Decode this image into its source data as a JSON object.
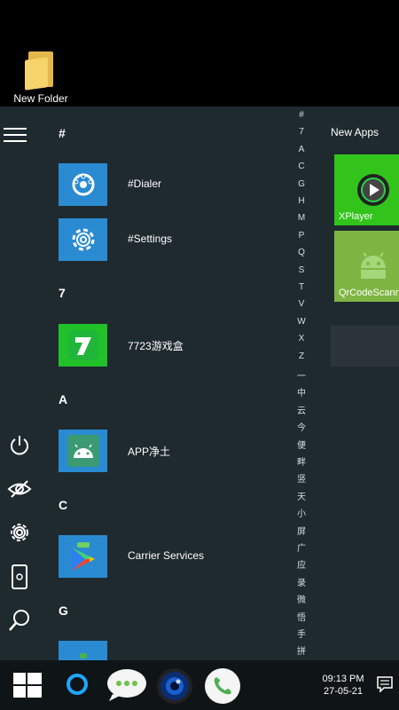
{
  "desktop": {
    "folder_label": "New Folder"
  },
  "start_menu": {
    "sections": [
      {
        "header": "#",
        "apps": [
          {
            "label": "#Dialer",
            "icon": "dialer-icon"
          },
          {
            "label": "#Settings",
            "icon": "gear-icon"
          }
        ]
      },
      {
        "header": "7",
        "apps": [
          {
            "label": "7723游戏盒",
            "icon": "7723-app-icon"
          }
        ]
      },
      {
        "header": "A",
        "apps": [
          {
            "label": "APP净土",
            "icon": "android-icon"
          }
        ]
      },
      {
        "header": "C",
        "apps": [
          {
            "label": "Carrier Services",
            "icon": "play-icon"
          }
        ]
      },
      {
        "header": "G",
        "apps": []
      }
    ],
    "alphabet": [
      "#",
      "7",
      "A",
      "C",
      "G",
      "H",
      "M",
      "P",
      "Q",
      "S",
      "T",
      "V",
      "W",
      "X",
      "Z",
      "一",
      "中",
      "云",
      "今",
      "便",
      "畔",
      "竖",
      "天",
      "小",
      "屏",
      "广",
      "应",
      "录",
      "微",
      "悟",
      "手",
      "拼"
    ],
    "new_apps_title": "New Apps",
    "tiles": [
      {
        "label": "XPlayer",
        "color": "#32c41b",
        "icon": "media-play-icon"
      },
      {
        "label": "QrCodeScanner",
        "color": "#7fb543",
        "icon": "android-icon"
      }
    ],
    "rail": [
      "menu-icon",
      "power-icon",
      "hidden-eye-icon",
      "gear-icon",
      "phone-device-icon",
      "search-icon"
    ]
  },
  "taskbar": {
    "time": "09:13 PM",
    "date": "27-05-21",
    "icons": [
      "windows-start-icon",
      "cortana-icon",
      "messages-icon",
      "camera-icon",
      "phone-call-icon",
      "notification-icon"
    ]
  },
  "colors": {
    "tile_blue": "#2a8bd2",
    "tile_green": "#21c129",
    "menu_bg": "#1f2a2f"
  }
}
